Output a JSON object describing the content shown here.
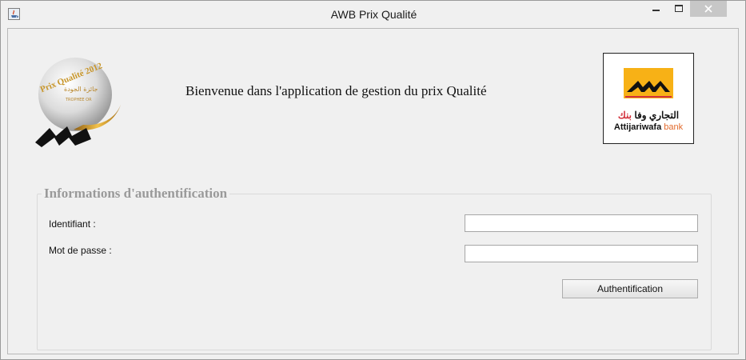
{
  "window": {
    "title": "AWB Prix Qualité",
    "controls": {
      "minimize": "–",
      "maximize": "☐",
      "close": "✕"
    }
  },
  "header": {
    "trophy_logo": {
      "icon": "trophy-logo",
      "text": "Prix Qualité 2012",
      "text_ar": "جائزة الجودة",
      "sub": "TROPHEE OR"
    },
    "welcome_text": "Bienvenue dans l'application de gestion du prix Qualité",
    "bank_logo": {
      "icon": "attijariwafa-logo",
      "name_ar_black": "التجاري وفا",
      "name_ar_red": " بنك",
      "name_en_black": "Attijariwafa",
      "name_en_red": " bank"
    }
  },
  "auth_group": {
    "title": "Informations d'authentification",
    "fields": {
      "identifiant_label": "Identifiant :",
      "identifiant_value": "",
      "password_label": "Mot de passe :",
      "password_value": ""
    },
    "submit_label": "Authentification"
  },
  "colors": {
    "brand_yellow": "#f7b116",
    "brand_red": "#d3313c",
    "brand_orange": "#e26a2c"
  }
}
